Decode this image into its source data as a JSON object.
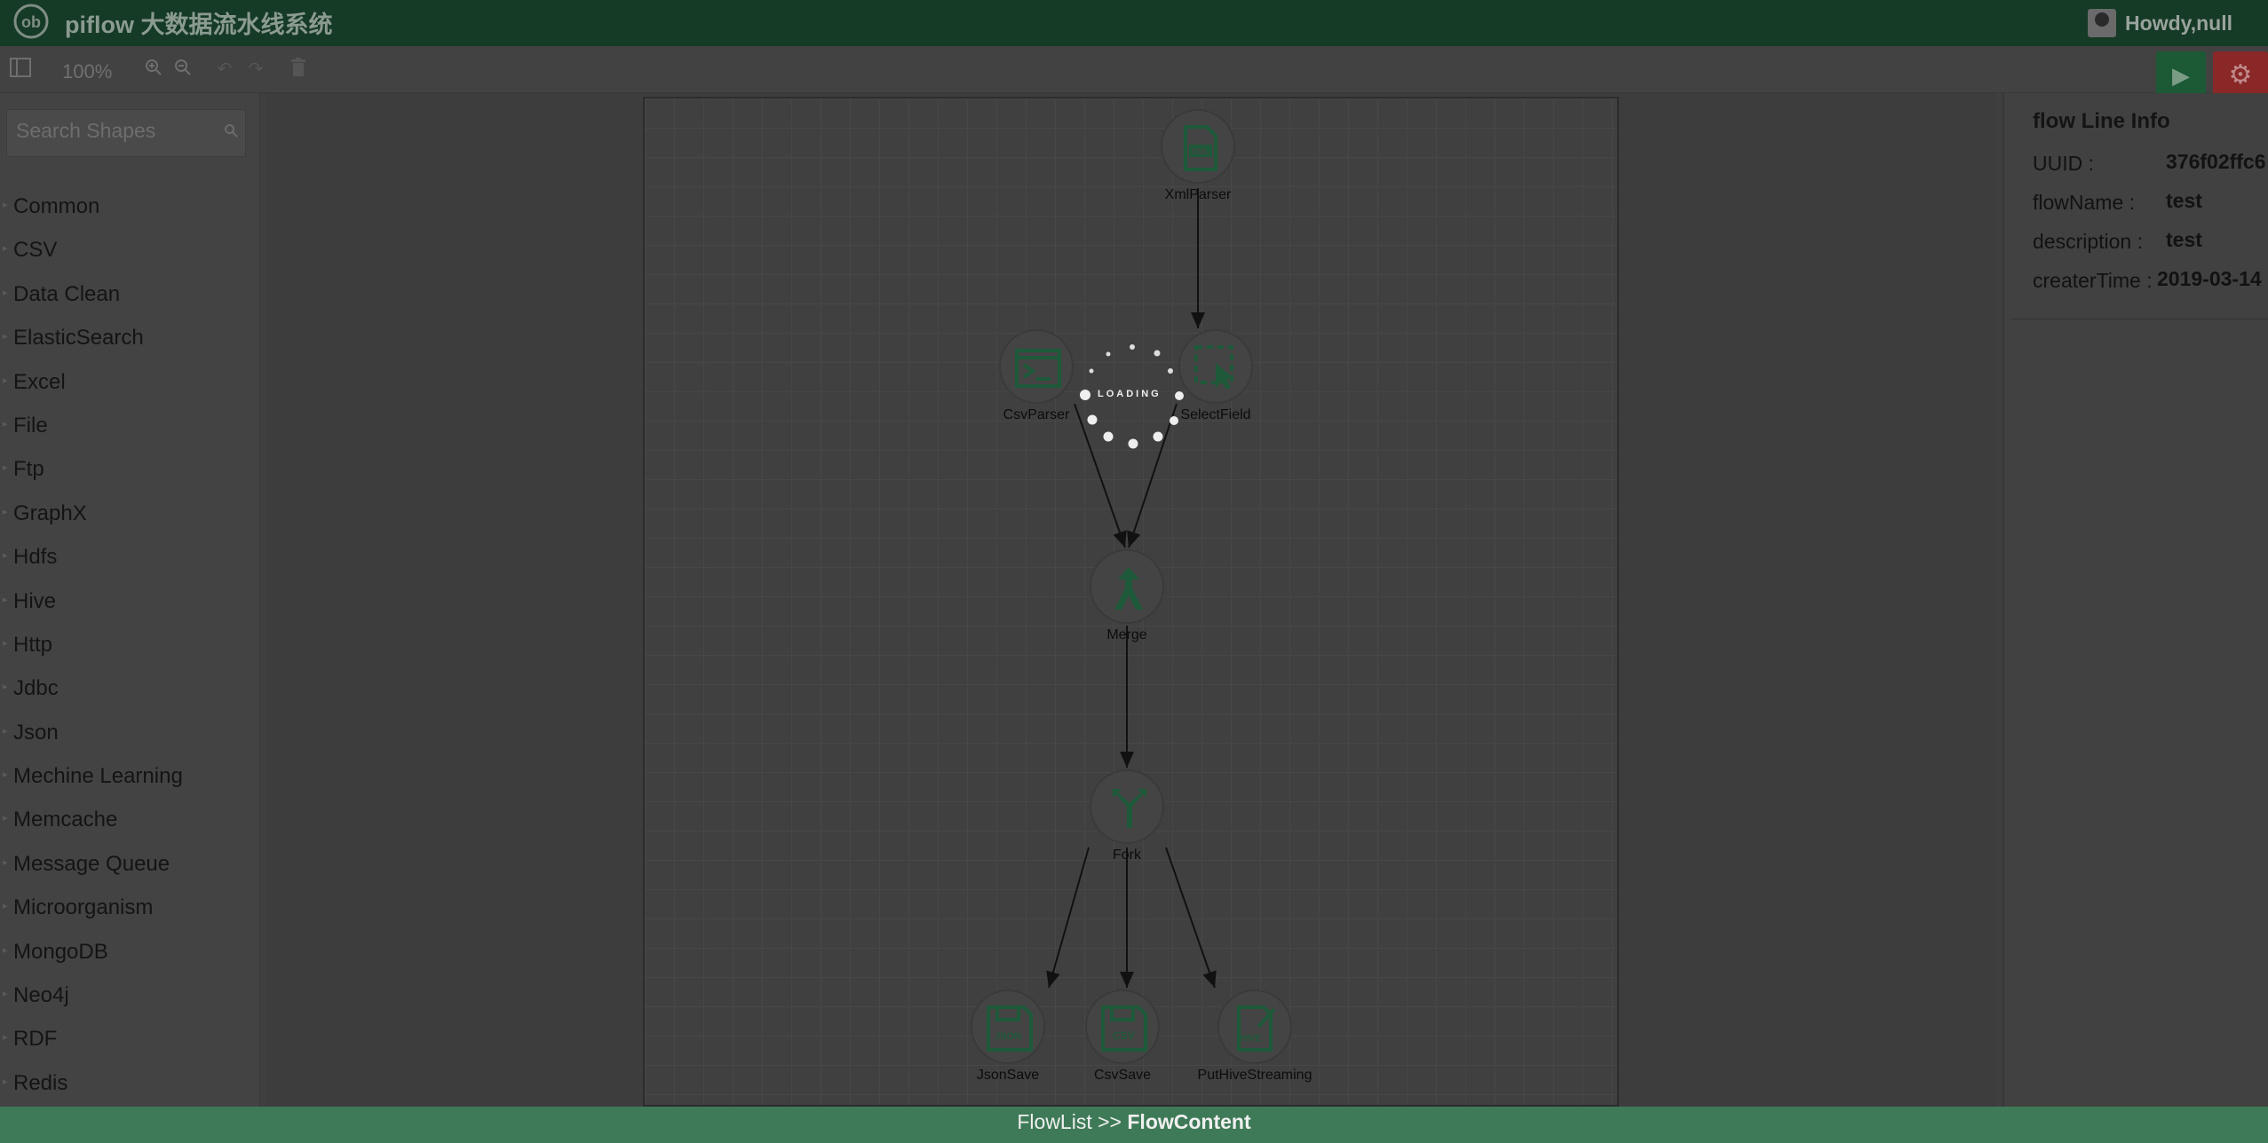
{
  "header": {
    "app_title": "piflow 大数据流水线系统",
    "greeting": "Howdy,null"
  },
  "toolbar": {
    "zoom_level": "100%"
  },
  "sidebar": {
    "search_placeholder": "Search Shapes",
    "categories": [
      "Common",
      "CSV",
      "Data Clean",
      "ElasticSearch",
      "Excel",
      "File",
      "Ftp",
      "GraphX",
      "Hdfs",
      "Hive",
      "Http",
      "Jdbc",
      "Json",
      "Mechine Learning",
      "Memcache",
      "Message Queue",
      "Microorganism",
      "MongoDB",
      "Neo4j",
      "RDF",
      "Redis"
    ]
  },
  "flow": {
    "loading_text": "LOADING",
    "nodes": [
      {
        "id": "xmlparser",
        "label": "XmlParser",
        "icon": "xml-file-icon"
      },
      {
        "id": "csvparser",
        "label": "CsvParser",
        "icon": "terminal-icon"
      },
      {
        "id": "selectfield",
        "label": "SelectField",
        "icon": "select-cursor-icon"
      },
      {
        "id": "merge",
        "label": "Merge",
        "icon": "merge-icon"
      },
      {
        "id": "fork",
        "label": "Fork",
        "icon": "fork-icon"
      },
      {
        "id": "jsonsave",
        "label": "JsonSave",
        "icon": "json-save-icon"
      },
      {
        "id": "csvsave",
        "label": "CsvSave",
        "icon": "csv-save-icon"
      },
      {
        "id": "puthivestreaming",
        "label": "PutHiveStreaming",
        "icon": "hive-icon"
      }
    ]
  },
  "info_panel": {
    "title": "flow Line Info",
    "rows": [
      {
        "key": "UUID :",
        "value": "376f02ffc6"
      },
      {
        "key": "flowName :",
        "value": "test"
      },
      {
        "key": "description :",
        "value": "test"
      },
      {
        "key": "createrTime :",
        "value": "2019-03-14"
      }
    ]
  },
  "footer": {
    "crumb_parent": "FlowList >> ",
    "crumb_current": "FlowContent"
  },
  "colors": {
    "header_bg": "#153a26",
    "run_button": "#1c5a36",
    "settings_button": "#8a2727",
    "footer_bg": "#3e7a57",
    "node_icon": "#1e5a3a"
  }
}
